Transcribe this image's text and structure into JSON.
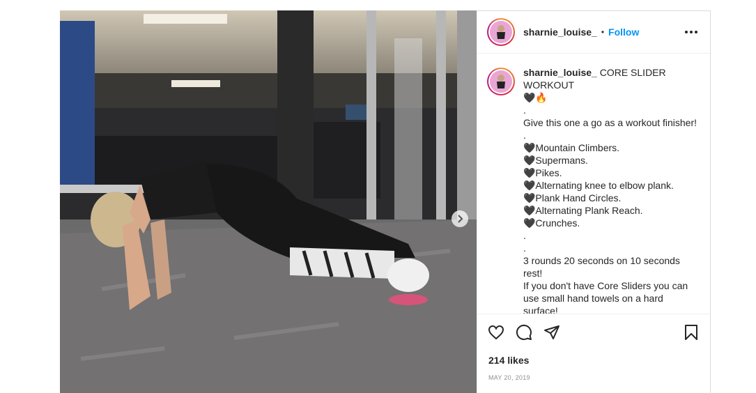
{
  "post": {
    "username": "sharnie_louise_",
    "separator": "•",
    "follow_label": "Follow",
    "caption_lines": [
      "CORE SLIDER WORKOUT",
      "🖤🔥",
      ".",
      "Give this one a go as a workout finisher!",
      ".",
      "🖤Mountain Climbers.",
      "🖤Supermans.",
      "🖤Pikes.",
      "🖤Alternating knee to elbow plank.",
      "🖤Plank Hand Circles.",
      "🖤Alternating Plank Reach.",
      "🖤Crunches.",
      ".",
      ".",
      "3 rounds 20 seconds on 10 seconds rest!",
      "If you don't have Core Sliders you can use small hand towels on a hard surface!",
      "🙊💪🏾🔥",
      "."
    ],
    "likes": "214 likes",
    "date": "MAY 20, 2019"
  },
  "icons": {
    "more": "more-options-icon",
    "like": "heart-icon",
    "comment": "comment-icon",
    "share": "share-icon",
    "save": "bookmark-icon",
    "next": "chevron-right-icon"
  },
  "colors": {
    "accent": "#0095f6",
    "text": "#262626",
    "muted": "#8e8e8e",
    "border": "#dbdbdb"
  }
}
